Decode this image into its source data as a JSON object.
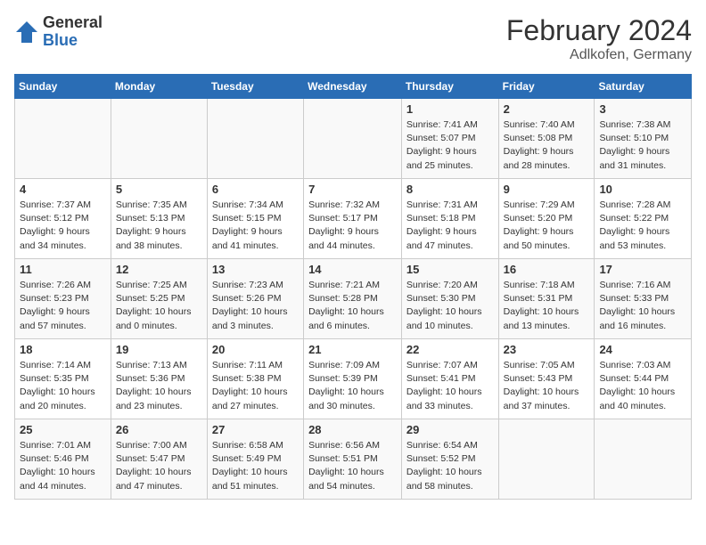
{
  "header": {
    "logo_general": "General",
    "logo_blue": "Blue",
    "month_title": "February 2024",
    "subtitle": "Adlkofen, Germany"
  },
  "days_of_week": [
    "Sunday",
    "Monday",
    "Tuesday",
    "Wednesday",
    "Thursday",
    "Friday",
    "Saturday"
  ],
  "weeks": [
    [
      {
        "num": "",
        "info": ""
      },
      {
        "num": "",
        "info": ""
      },
      {
        "num": "",
        "info": ""
      },
      {
        "num": "",
        "info": ""
      },
      {
        "num": "1",
        "info": "Sunrise: 7:41 AM\nSunset: 5:07 PM\nDaylight: 9 hours\nand 25 minutes."
      },
      {
        "num": "2",
        "info": "Sunrise: 7:40 AM\nSunset: 5:08 PM\nDaylight: 9 hours\nand 28 minutes."
      },
      {
        "num": "3",
        "info": "Sunrise: 7:38 AM\nSunset: 5:10 PM\nDaylight: 9 hours\nand 31 minutes."
      }
    ],
    [
      {
        "num": "4",
        "info": "Sunrise: 7:37 AM\nSunset: 5:12 PM\nDaylight: 9 hours\nand 34 minutes."
      },
      {
        "num": "5",
        "info": "Sunrise: 7:35 AM\nSunset: 5:13 PM\nDaylight: 9 hours\nand 38 minutes."
      },
      {
        "num": "6",
        "info": "Sunrise: 7:34 AM\nSunset: 5:15 PM\nDaylight: 9 hours\nand 41 minutes."
      },
      {
        "num": "7",
        "info": "Sunrise: 7:32 AM\nSunset: 5:17 PM\nDaylight: 9 hours\nand 44 minutes."
      },
      {
        "num": "8",
        "info": "Sunrise: 7:31 AM\nSunset: 5:18 PM\nDaylight: 9 hours\nand 47 minutes."
      },
      {
        "num": "9",
        "info": "Sunrise: 7:29 AM\nSunset: 5:20 PM\nDaylight: 9 hours\nand 50 minutes."
      },
      {
        "num": "10",
        "info": "Sunrise: 7:28 AM\nSunset: 5:22 PM\nDaylight: 9 hours\nand 53 minutes."
      }
    ],
    [
      {
        "num": "11",
        "info": "Sunrise: 7:26 AM\nSunset: 5:23 PM\nDaylight: 9 hours\nand 57 minutes."
      },
      {
        "num": "12",
        "info": "Sunrise: 7:25 AM\nSunset: 5:25 PM\nDaylight: 10 hours\nand 0 minutes."
      },
      {
        "num": "13",
        "info": "Sunrise: 7:23 AM\nSunset: 5:26 PM\nDaylight: 10 hours\nand 3 minutes."
      },
      {
        "num": "14",
        "info": "Sunrise: 7:21 AM\nSunset: 5:28 PM\nDaylight: 10 hours\nand 6 minutes."
      },
      {
        "num": "15",
        "info": "Sunrise: 7:20 AM\nSunset: 5:30 PM\nDaylight: 10 hours\nand 10 minutes."
      },
      {
        "num": "16",
        "info": "Sunrise: 7:18 AM\nSunset: 5:31 PM\nDaylight: 10 hours\nand 13 minutes."
      },
      {
        "num": "17",
        "info": "Sunrise: 7:16 AM\nSunset: 5:33 PM\nDaylight: 10 hours\nand 16 minutes."
      }
    ],
    [
      {
        "num": "18",
        "info": "Sunrise: 7:14 AM\nSunset: 5:35 PM\nDaylight: 10 hours\nand 20 minutes."
      },
      {
        "num": "19",
        "info": "Sunrise: 7:13 AM\nSunset: 5:36 PM\nDaylight: 10 hours\nand 23 minutes."
      },
      {
        "num": "20",
        "info": "Sunrise: 7:11 AM\nSunset: 5:38 PM\nDaylight: 10 hours\nand 27 minutes."
      },
      {
        "num": "21",
        "info": "Sunrise: 7:09 AM\nSunset: 5:39 PM\nDaylight: 10 hours\nand 30 minutes."
      },
      {
        "num": "22",
        "info": "Sunrise: 7:07 AM\nSunset: 5:41 PM\nDaylight: 10 hours\nand 33 minutes."
      },
      {
        "num": "23",
        "info": "Sunrise: 7:05 AM\nSunset: 5:43 PM\nDaylight: 10 hours\nand 37 minutes."
      },
      {
        "num": "24",
        "info": "Sunrise: 7:03 AM\nSunset: 5:44 PM\nDaylight: 10 hours\nand 40 minutes."
      }
    ],
    [
      {
        "num": "25",
        "info": "Sunrise: 7:01 AM\nSunset: 5:46 PM\nDaylight: 10 hours\nand 44 minutes."
      },
      {
        "num": "26",
        "info": "Sunrise: 7:00 AM\nSunset: 5:47 PM\nDaylight: 10 hours\nand 47 minutes."
      },
      {
        "num": "27",
        "info": "Sunrise: 6:58 AM\nSunset: 5:49 PM\nDaylight: 10 hours\nand 51 minutes."
      },
      {
        "num": "28",
        "info": "Sunrise: 6:56 AM\nSunset: 5:51 PM\nDaylight: 10 hours\nand 54 minutes."
      },
      {
        "num": "29",
        "info": "Sunrise: 6:54 AM\nSunset: 5:52 PM\nDaylight: 10 hours\nand 58 minutes."
      },
      {
        "num": "",
        "info": ""
      },
      {
        "num": "",
        "info": ""
      }
    ]
  ]
}
